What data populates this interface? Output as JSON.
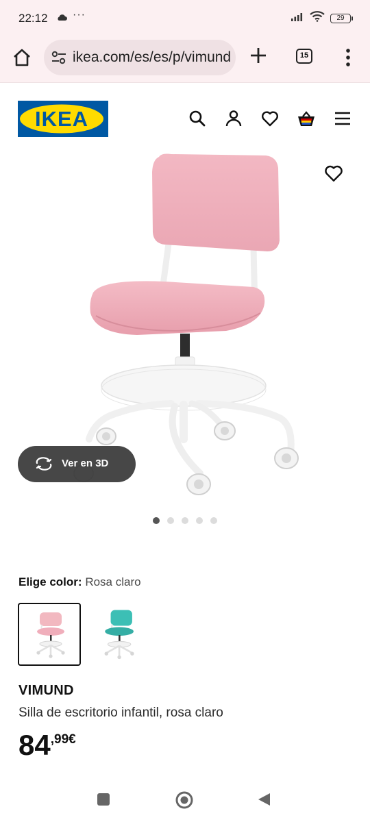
{
  "status_bar": {
    "time": "22:12",
    "more": "···",
    "battery": "29"
  },
  "browser": {
    "url": "ikea.com/es/es/p/vimund",
    "tab_count": "15"
  },
  "header": {
    "logo_text": "IKEA",
    "logo_colors": {
      "blue": "#0058a3",
      "yellow": "#ffdb00"
    }
  },
  "product": {
    "view_3d_label": "Ver en 3D",
    "gallery_count": 5,
    "gallery_active": 0,
    "color_label": "Elige color:",
    "color_value": "Rosa claro",
    "swatches": [
      {
        "name": "rosa-claro",
        "color": "#f2b8c0",
        "selected": true
      },
      {
        "name": "turquesa",
        "color": "#3cbfb5",
        "selected": false
      }
    ],
    "name": "VIMUND",
    "description": "Silla de escritorio infantil, rosa claro",
    "price_int": "84",
    "price_dec": ",99€"
  },
  "icons": {
    "status": [
      "cloud-icon",
      "signal-icon",
      "wifi-icon",
      "battery-icon"
    ],
    "browser": [
      "home-icon",
      "site-settings-icon",
      "new-tab-plus-icon",
      "tabs-counter-icon",
      "more-vert-icon"
    ],
    "header": [
      "search-icon",
      "user-icon",
      "heart-icon",
      "shopping-bag-icon",
      "menu-icon"
    ],
    "nav": [
      "recents-square-icon",
      "home-circle-icon",
      "back-triangle-icon"
    ]
  }
}
